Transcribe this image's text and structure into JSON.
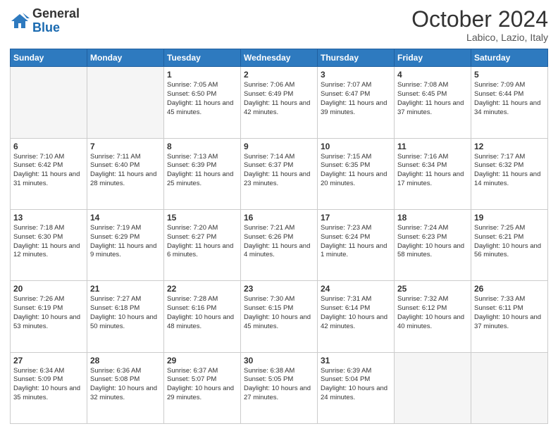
{
  "header": {
    "logo_general": "General",
    "logo_blue": "Blue",
    "month_year": "October 2024",
    "location": "Labico, Lazio, Italy"
  },
  "days_of_week": [
    "Sunday",
    "Monday",
    "Tuesday",
    "Wednesday",
    "Thursday",
    "Friday",
    "Saturday"
  ],
  "weeks": [
    [
      {
        "day": "",
        "sunrise": "",
        "sunset": "",
        "daylight": ""
      },
      {
        "day": "",
        "sunrise": "",
        "sunset": "",
        "daylight": ""
      },
      {
        "day": "1",
        "sunrise": "Sunrise: 7:05 AM",
        "sunset": "Sunset: 6:50 PM",
        "daylight": "Daylight: 11 hours and 45 minutes."
      },
      {
        "day": "2",
        "sunrise": "Sunrise: 7:06 AM",
        "sunset": "Sunset: 6:49 PM",
        "daylight": "Daylight: 11 hours and 42 minutes."
      },
      {
        "day": "3",
        "sunrise": "Sunrise: 7:07 AM",
        "sunset": "Sunset: 6:47 PM",
        "daylight": "Daylight: 11 hours and 39 minutes."
      },
      {
        "day": "4",
        "sunrise": "Sunrise: 7:08 AM",
        "sunset": "Sunset: 6:45 PM",
        "daylight": "Daylight: 11 hours and 37 minutes."
      },
      {
        "day": "5",
        "sunrise": "Sunrise: 7:09 AM",
        "sunset": "Sunset: 6:44 PM",
        "daylight": "Daylight: 11 hours and 34 minutes."
      }
    ],
    [
      {
        "day": "6",
        "sunrise": "Sunrise: 7:10 AM",
        "sunset": "Sunset: 6:42 PM",
        "daylight": "Daylight: 11 hours and 31 minutes."
      },
      {
        "day": "7",
        "sunrise": "Sunrise: 7:11 AM",
        "sunset": "Sunset: 6:40 PM",
        "daylight": "Daylight: 11 hours and 28 minutes."
      },
      {
        "day": "8",
        "sunrise": "Sunrise: 7:13 AM",
        "sunset": "Sunset: 6:39 PM",
        "daylight": "Daylight: 11 hours and 25 minutes."
      },
      {
        "day": "9",
        "sunrise": "Sunrise: 7:14 AM",
        "sunset": "Sunset: 6:37 PM",
        "daylight": "Daylight: 11 hours and 23 minutes."
      },
      {
        "day": "10",
        "sunrise": "Sunrise: 7:15 AM",
        "sunset": "Sunset: 6:35 PM",
        "daylight": "Daylight: 11 hours and 20 minutes."
      },
      {
        "day": "11",
        "sunrise": "Sunrise: 7:16 AM",
        "sunset": "Sunset: 6:34 PM",
        "daylight": "Daylight: 11 hours and 17 minutes."
      },
      {
        "day": "12",
        "sunrise": "Sunrise: 7:17 AM",
        "sunset": "Sunset: 6:32 PM",
        "daylight": "Daylight: 11 hours and 14 minutes."
      }
    ],
    [
      {
        "day": "13",
        "sunrise": "Sunrise: 7:18 AM",
        "sunset": "Sunset: 6:30 PM",
        "daylight": "Daylight: 11 hours and 12 minutes."
      },
      {
        "day": "14",
        "sunrise": "Sunrise: 7:19 AM",
        "sunset": "Sunset: 6:29 PM",
        "daylight": "Daylight: 11 hours and 9 minutes."
      },
      {
        "day": "15",
        "sunrise": "Sunrise: 7:20 AM",
        "sunset": "Sunset: 6:27 PM",
        "daylight": "Daylight: 11 hours and 6 minutes."
      },
      {
        "day": "16",
        "sunrise": "Sunrise: 7:21 AM",
        "sunset": "Sunset: 6:26 PM",
        "daylight": "Daylight: 11 hours and 4 minutes."
      },
      {
        "day": "17",
        "sunrise": "Sunrise: 7:23 AM",
        "sunset": "Sunset: 6:24 PM",
        "daylight": "Daylight: 11 hours and 1 minute."
      },
      {
        "day": "18",
        "sunrise": "Sunrise: 7:24 AM",
        "sunset": "Sunset: 6:23 PM",
        "daylight": "Daylight: 10 hours and 58 minutes."
      },
      {
        "day": "19",
        "sunrise": "Sunrise: 7:25 AM",
        "sunset": "Sunset: 6:21 PM",
        "daylight": "Daylight: 10 hours and 56 minutes."
      }
    ],
    [
      {
        "day": "20",
        "sunrise": "Sunrise: 7:26 AM",
        "sunset": "Sunset: 6:19 PM",
        "daylight": "Daylight: 10 hours and 53 minutes."
      },
      {
        "day": "21",
        "sunrise": "Sunrise: 7:27 AM",
        "sunset": "Sunset: 6:18 PM",
        "daylight": "Daylight: 10 hours and 50 minutes."
      },
      {
        "day": "22",
        "sunrise": "Sunrise: 7:28 AM",
        "sunset": "Sunset: 6:16 PM",
        "daylight": "Daylight: 10 hours and 48 minutes."
      },
      {
        "day": "23",
        "sunrise": "Sunrise: 7:30 AM",
        "sunset": "Sunset: 6:15 PM",
        "daylight": "Daylight: 10 hours and 45 minutes."
      },
      {
        "day": "24",
        "sunrise": "Sunrise: 7:31 AM",
        "sunset": "Sunset: 6:14 PM",
        "daylight": "Daylight: 10 hours and 42 minutes."
      },
      {
        "day": "25",
        "sunrise": "Sunrise: 7:32 AM",
        "sunset": "Sunset: 6:12 PM",
        "daylight": "Daylight: 10 hours and 40 minutes."
      },
      {
        "day": "26",
        "sunrise": "Sunrise: 7:33 AM",
        "sunset": "Sunset: 6:11 PM",
        "daylight": "Daylight: 10 hours and 37 minutes."
      }
    ],
    [
      {
        "day": "27",
        "sunrise": "Sunrise: 6:34 AM",
        "sunset": "Sunset: 5:09 PM",
        "daylight": "Daylight: 10 hours and 35 minutes."
      },
      {
        "day": "28",
        "sunrise": "Sunrise: 6:36 AM",
        "sunset": "Sunset: 5:08 PM",
        "daylight": "Daylight: 10 hours and 32 minutes."
      },
      {
        "day": "29",
        "sunrise": "Sunrise: 6:37 AM",
        "sunset": "Sunset: 5:07 PM",
        "daylight": "Daylight: 10 hours and 29 minutes."
      },
      {
        "day": "30",
        "sunrise": "Sunrise: 6:38 AM",
        "sunset": "Sunset: 5:05 PM",
        "daylight": "Daylight: 10 hours and 27 minutes."
      },
      {
        "day": "31",
        "sunrise": "Sunrise: 6:39 AM",
        "sunset": "Sunset: 5:04 PM",
        "daylight": "Daylight: 10 hours and 24 minutes."
      },
      {
        "day": "",
        "sunrise": "",
        "sunset": "",
        "daylight": ""
      },
      {
        "day": "",
        "sunrise": "",
        "sunset": "",
        "daylight": ""
      }
    ]
  ]
}
